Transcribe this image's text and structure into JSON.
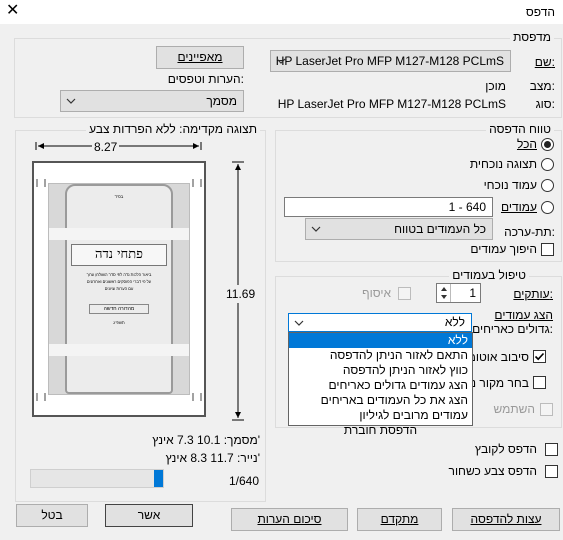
{
  "window": {
    "title": "הדפס",
    "close_glyph": "✕"
  },
  "printer": {
    "legend": "מדפסת",
    "name_label": "שם:",
    "name_value": "HP LaserJet Pro MFP M127-M128 PCLmS",
    "status_label": "מצב:",
    "status_value": "מוכן",
    "type_label": "סוג:",
    "type_value": "HP LaserJet Pro MFP M127-M128 PCLmS",
    "properties_button": "מאפיינים",
    "comments_label": "הערות וטפסים:",
    "comments_value": "מסמך"
  },
  "range": {
    "legend": "טווח הדפסה",
    "all": "הכל",
    "current_view": "תצוגה נוכחית",
    "current_page": "עמוד נוכחי",
    "pages": "עמודים",
    "pages_value": "1 - 640",
    "subset_label": "תת-ערכה:",
    "subset_value": "כל העמודים בטווח",
    "reverse": "היפוך עמודים"
  },
  "handling": {
    "legend": "טיפול בעמודים",
    "copies_label": "עותקים:",
    "copies_value": "1",
    "collate": "איסוף",
    "scaling_label_1": "הצג עמודים",
    "scaling_label_2": "גדולים כאריחים:",
    "scaling_value": "ללא",
    "auto_rotate": "סיבוב אוטומ",
    "paper_source": "בחר מקור ני",
    "use_pdf": "השתמש"
  },
  "dropdown": {
    "items": [
      "ללא",
      "התאם לאזור הניתן להדפסה",
      "כווץ לאזור הניתן להדפסה",
      "הצג עמודים גדולים כאריחים",
      "הצג את כל העמודים באריחים",
      "עמודים מרובים לגיליון",
      "הדפסת חוברת"
    ]
  },
  "preview": {
    "legend": "תצוגה מקדימה: ללא הפרדות צבע",
    "width": "8.27",
    "height": "11.69",
    "document_size": "מסמך: 10.1 7.3 אינץ'",
    "paper_size": "נייר: 11.7 8.3 אינץ'",
    "page_counter": "1/640",
    "page_fraction": 0.0016,
    "doc_text": {
      "small_top": "בס\"ד",
      "title": "פתחי נדה",
      "lines": [
        "ביאור הלכות נדה לפי סדר השולחן ערוך",
        "על פי דברי הפוסקים ראשונים ואחרונים",
        "עם הערות וציונים"
      ],
      "edition": "מהדורה חדשה",
      "year": "תשפ\"ג"
    }
  },
  "options": {
    "print_to_file": "הדפס לקובץ",
    "print_bw": "הדפס צבע כשחור"
  },
  "buttons": {
    "print_tips": "עצות להדפסה",
    "advanced": "מתקדם",
    "summarize_comments": "סיכום הערות",
    "ok": "אשר",
    "cancel": "בטל"
  },
  "colors": {
    "accent": "#0078d7",
    "scrollbar_thumb": "#0078d7"
  }
}
